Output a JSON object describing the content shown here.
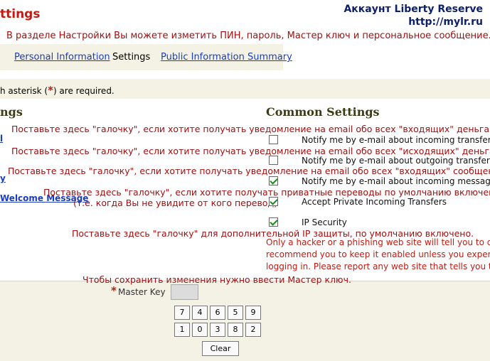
{
  "header": {
    "title": "ttings",
    "account_line1": "Аккаунт Liberty Reserve",
    "account_line2": "http://mylr.ru"
  },
  "intro_text": "В разделе Настройки Вы можете изметить ПИН, пароль, Мастер ключ и персональное сообщение.",
  "tabs": [
    {
      "label": "Personal Information",
      "active": false
    },
    {
      "label": "Settings",
      "active": true
    },
    {
      "label": "Public Information Summary",
      "active": false
    }
  ],
  "required_note": {
    "prefix": "h asterisk (",
    "star": "*",
    "suffix": ") are required."
  },
  "left_section": {
    "heading": "ngs",
    "link_fragment_1": "l",
    "link_fragment_2": "y",
    "welcome_link": "Welcome Message"
  },
  "common_settings": {
    "heading": "Common Settings",
    "hints": {
      "incoming_transfers": "Поставьте здесь \"галочку\", если хотите получать уведомление на email обо всех \"входящих\" деньгах",
      "outgoing_transfers": "Поставьте здесь \"галочку\", если хотите получать уведомление на email обо всех \"исходящих\" деньгах",
      "incoming_messages": "Поставьте здесь \"галочку\", если хотите получать уведомление на email обо всех \"входящих\" сообщениях",
      "private_transfers_1": "Поставьте здесь \"галочку\", если хотите получать приватные переводы по умолчанию включено",
      "private_transfers_2": "(т.е. когда Вы не увидите от кого перевод)",
      "ip_security": "Поставьте здесь \"галочку\" для дополнительной IP защиты, по умолчанию включено."
    },
    "options": [
      {
        "label": "Notify me by e-mail about incoming transfers",
        "checked": false
      },
      {
        "label": "Notify me by e-mail about outgoing transfers",
        "checked": false
      },
      {
        "label": "Notify me by e-mail about incoming messages",
        "checked": true
      },
      {
        "label": "Accept Private Incoming Transfers",
        "checked": true
      },
      {
        "label": "IP Security",
        "checked": true
      }
    ],
    "warning_lines": [
      "Only a hacker or a phishing web site will tell you to dis",
      "recommend you to keep it enabled unless you experien",
      "logging in. Please report any web site that tells you to"
    ]
  },
  "master_key": {
    "save_hint": "Чтобы сохранить изменения нужно ввести Мастер ключ.",
    "star": "*",
    "label": "Master Key",
    "value": "",
    "keypad_row1": [
      "7",
      "4",
      "6",
      "5",
      "9"
    ],
    "keypad_row2": [
      "1",
      "0",
      "3",
      "8",
      "2"
    ],
    "clear_label": "Clear"
  },
  "colors": {
    "accent_red": "#c41a12",
    "hint_red": "#a01010",
    "link_blue": "#1a3dbd",
    "panel_beige": "#f3f2e4",
    "heading_olive": "#3d3b16",
    "account_navy": "#0c1f6c"
  }
}
